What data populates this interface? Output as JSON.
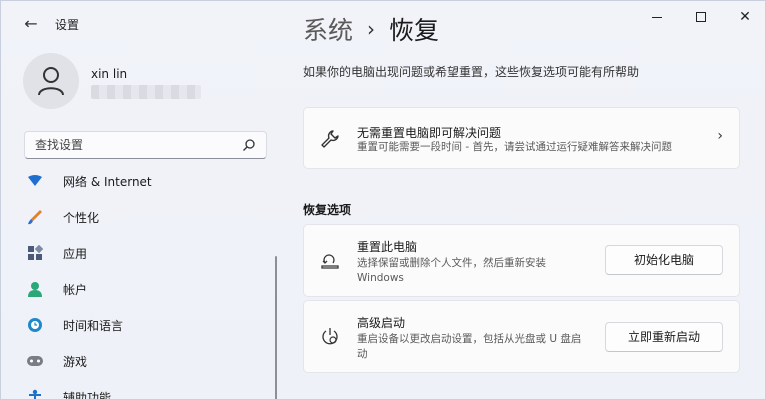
{
  "window": {
    "app_title": "设置",
    "back_label": "←",
    "controls": {
      "minimize": "minimize",
      "maximize": "maximize",
      "close": "✕"
    }
  },
  "user": {
    "name": "xin lin"
  },
  "search": {
    "placeholder": "查找设置"
  },
  "sidebar": {
    "items": [
      {
        "label": "网络 & Internet",
        "icon": "wifi-icon",
        "color": "#1f6fd1"
      },
      {
        "label": "个性化",
        "icon": "brush-icon",
        "color": "#e0822d"
      },
      {
        "label": "应用",
        "icon": "apps-icon",
        "color": "#4a5a78"
      },
      {
        "label": "帐户",
        "icon": "account-icon",
        "color": "#2ba77a"
      },
      {
        "label": "时间和语言",
        "icon": "globe-clock-icon",
        "color": "#1e88c9"
      },
      {
        "label": "游戏",
        "icon": "gamepad-icon",
        "color": "#7a7d85"
      },
      {
        "label": "辅助功能",
        "icon": "accessibility-icon",
        "color": "#1a73c9"
      }
    ]
  },
  "breadcrumb": {
    "parent": "系统",
    "separator": "›",
    "current": "恢复"
  },
  "subtitle": "如果你的电脑出现问题或希望重置，这些恢复选项可能有所帮助",
  "fix_card": {
    "title": "无需重置电脑即可解决问题",
    "desc": "重置可能需要一段时间 - 首先，请尝试通过运行疑难解答来解决问题",
    "chevron": "›"
  },
  "section_title": "恢复选项",
  "reset_card": {
    "title": "重置此电脑",
    "desc_line1": "选择保留或删除个人文件，然后重新安装",
    "desc_line2": "Windows",
    "button": "初始化电脑"
  },
  "advanced_card": {
    "title": "高级启动",
    "desc_line1": "重启设备以更改启动设置，包括从光盘或 U 盘启",
    "desc_line2": "动",
    "button": "立即重新启动"
  }
}
